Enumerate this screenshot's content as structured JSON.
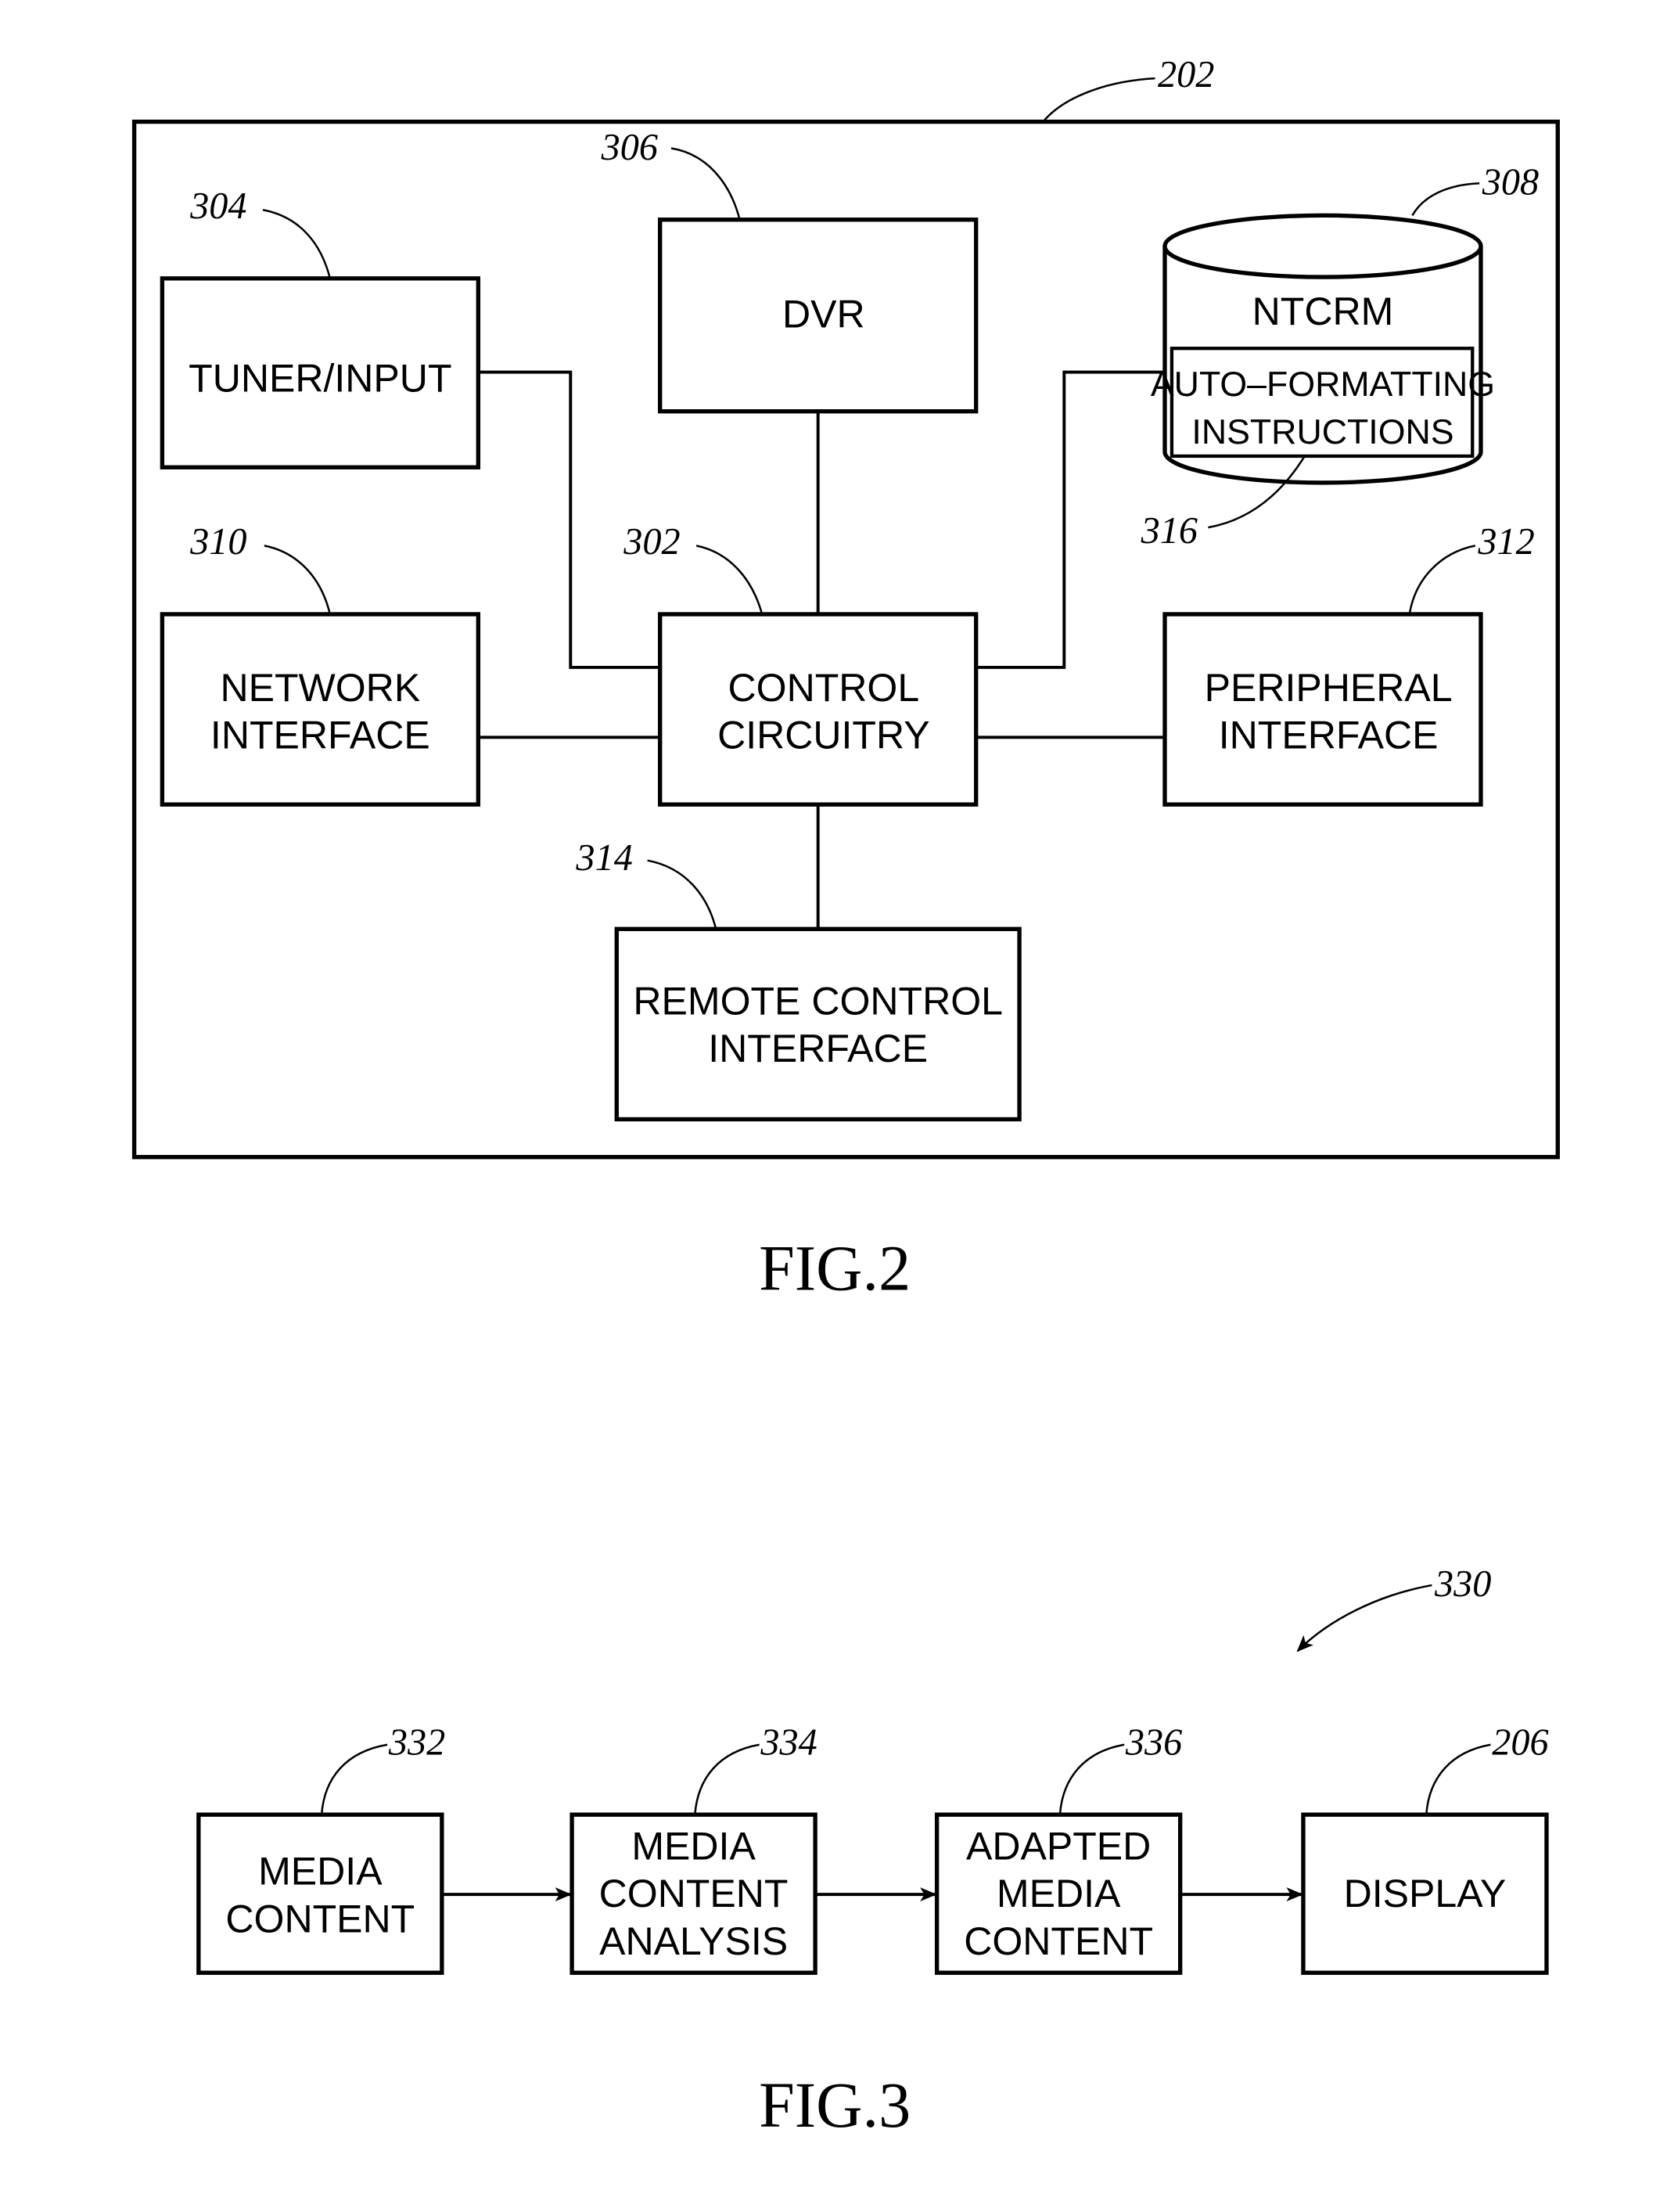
{
  "figures": [
    {
      "caption": "FIG.2",
      "ref": "202",
      "blocks": {
        "tuner": {
          "ref": "304",
          "lines": [
            "TUNER/INPUT"
          ]
        },
        "dvr": {
          "ref": "306",
          "lines": [
            "DVR"
          ]
        },
        "ntcrm": {
          "ref": "308",
          "lines": [
            "NTCRM"
          ]
        },
        "auto_formatting": {
          "ref": "316",
          "lines": [
            "AUTO–FORMATTING",
            "INSTRUCTIONS"
          ]
        },
        "network": {
          "ref": "310",
          "lines": [
            "NETWORK",
            "INTERFACE"
          ]
        },
        "control": {
          "ref": "302",
          "lines": [
            "CONTROL",
            "CIRCUITRY"
          ]
        },
        "peripheral": {
          "ref": "312",
          "lines": [
            "PERIPHERAL",
            "INTERFACE"
          ]
        },
        "remote": {
          "ref": "314",
          "lines": [
            "REMOTE  CONTROL",
            "INTERFACE"
          ]
        }
      }
    },
    {
      "caption": "FIG.3",
      "ref": "330",
      "blocks": {
        "media_content": {
          "ref": "332",
          "lines": [
            "MEDIA",
            "CONTENT"
          ]
        },
        "analysis": {
          "ref": "334",
          "lines": [
            "MEDIA",
            "CONTENT",
            "ANALYSIS"
          ]
        },
        "adapted": {
          "ref": "336",
          "lines": [
            "ADAPTED",
            "MEDIA",
            "CONTENT"
          ]
        },
        "display": {
          "ref": "206",
          "lines": [
            "DISPLAY"
          ]
        }
      }
    }
  ]
}
